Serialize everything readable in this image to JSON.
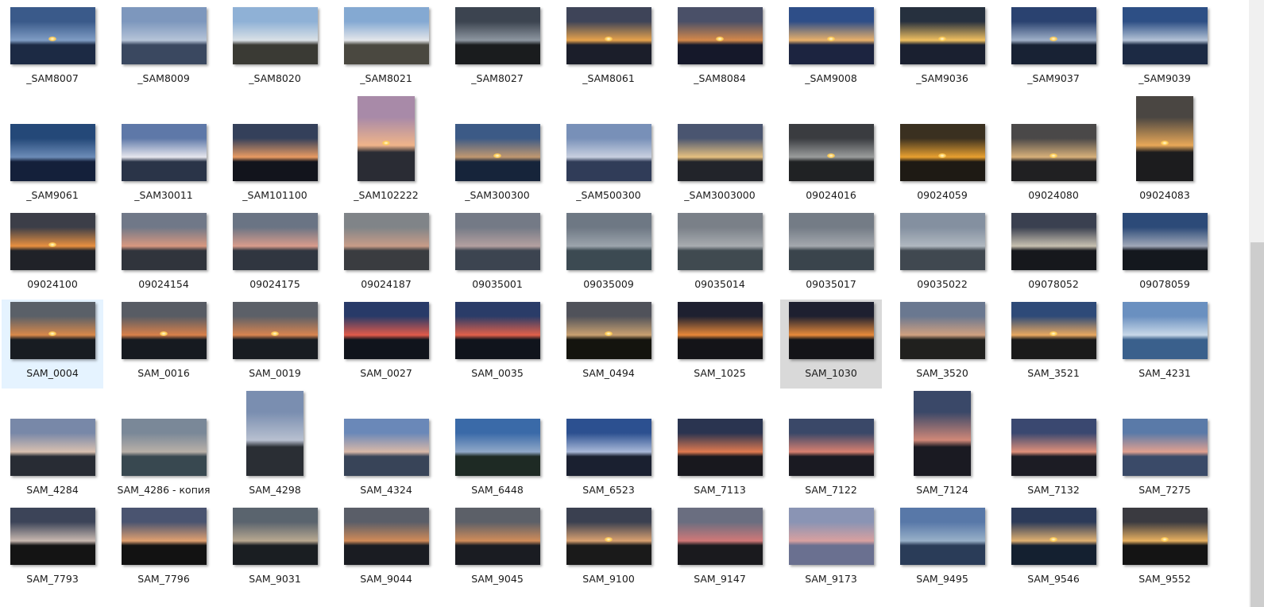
{
  "rows": [
    {
      "tall": false,
      "items": [
        {
          "name": "_SAM8007",
          "orient": "landscape",
          "c": [
            "#3a5a8a",
            "#7f9cc4",
            "#1c2a44"
          ],
          "sun": true
        },
        {
          "name": "_SAM8009",
          "orient": "landscape",
          "c": [
            "#7d97bd",
            "#b6c4d8",
            "#3a4860"
          ]
        },
        {
          "name": "_SAM8020",
          "orient": "landscape",
          "c": [
            "#8fb1d6",
            "#d9e0e6",
            "#3a3a34"
          ]
        },
        {
          "name": "_SAM8021",
          "orient": "landscape",
          "c": [
            "#84a9d2",
            "#e3e6ea",
            "#4a4840"
          ]
        },
        {
          "name": "_SAM8027",
          "orient": "landscape",
          "c": [
            "#3c4450",
            "#8d96a0",
            "#1a1c1e"
          ]
        },
        {
          "name": "_SAM8061",
          "orient": "landscape",
          "c": [
            "#3e4458",
            "#e6a24c",
            "#1b1e2a"
          ],
          "sun": true
        },
        {
          "name": "_SAM8084",
          "orient": "landscape",
          "c": [
            "#4a5068",
            "#d4884a",
            "#15182a"
          ],
          "sun": true
        },
        {
          "name": "_SAM9008",
          "orient": "landscape",
          "c": [
            "#2e4e88",
            "#e8b06a",
            "#1c2440"
          ],
          "sun": true
        },
        {
          "name": "_SAM9036",
          "orient": "landscape",
          "c": [
            "#26303e",
            "#f0c060",
            "#1a2030"
          ],
          "sun": true
        },
        {
          "name": "_SAM9037",
          "orient": "landscape",
          "c": [
            "#2a4270",
            "#9fb0c8",
            "#182234"
          ],
          "sun": true
        },
        {
          "name": "_SAM9039",
          "orient": "landscape",
          "c": [
            "#2d4f85",
            "#b3c2d6",
            "#1c2a44"
          ]
        }
      ]
    },
    {
      "tall": true,
      "items": [
        {
          "name": "_SAM9061",
          "orient": "landscape",
          "c": [
            "#244878",
            "#6c8cb8",
            "#14203a"
          ]
        },
        {
          "name": "_SAM30011",
          "orient": "landscape",
          "c": [
            "#5e78a8",
            "#e6e6ee",
            "#2a3448"
          ]
        },
        {
          "name": "_SAM101100",
          "orient": "landscape",
          "c": [
            "#34405a",
            "#e89a62",
            "#12141c"
          ]
        },
        {
          "name": "_SAM102222",
          "orient": "portrait",
          "c": [
            "#a88aa8",
            "#f0b48a",
            "#2a2c34"
          ],
          "sun": true
        },
        {
          "name": "_SAM300300",
          "orient": "landscape",
          "c": [
            "#3c5a86",
            "#c09870",
            "#16243a"
          ],
          "sun": true
        },
        {
          "name": "_SAM500300",
          "orient": "landscape",
          "c": [
            "#7890b8",
            "#c8d0e0",
            "#303c58"
          ]
        },
        {
          "name": "_SAM3003000",
          "orient": "landscape",
          "c": [
            "#4a5570",
            "#e6c080",
            "#22242a"
          ]
        },
        {
          "name": "09024016",
          "orient": "landscape",
          "c": [
            "#3a3c40",
            "#9a9c9c",
            "#202224"
          ],
          "sun": true
        },
        {
          "name": "09024059",
          "orient": "landscape",
          "c": [
            "#3a3020",
            "#e8a030",
            "#1e1a14"
          ],
          "sun": true
        },
        {
          "name": "09024080",
          "orient": "landscape",
          "c": [
            "#4a4848",
            "#d8b07a",
            "#202022"
          ],
          "sun": true
        },
        {
          "name": "09024083",
          "orient": "portrait",
          "c": [
            "#4a4642",
            "#e8a858",
            "#1c1c1e"
          ],
          "sun": true
        }
      ]
    },
    {
      "tall": false,
      "items": [
        {
          "name": "09024100",
          "orient": "landscape",
          "c": [
            "#3c3e48",
            "#e89040",
            "#202228"
          ],
          "sun": true
        },
        {
          "name": "09024154",
          "orient": "landscape",
          "c": [
            "#707888",
            "#d89880",
            "#30343c"
          ]
        },
        {
          "name": "09024175",
          "orient": "landscape",
          "c": [
            "#6a7484",
            "#d89c8c",
            "#303640"
          ]
        },
        {
          "name": "09024187",
          "orient": "landscape",
          "c": [
            "#808488",
            "#c89c88",
            "#3a3c40"
          ]
        },
        {
          "name": "09035001",
          "orient": "landscape",
          "c": [
            "#747a86",
            "#b4a0a0",
            "#3c4450"
          ]
        },
        {
          "name": "09035009",
          "orient": "landscape",
          "c": [
            "#6e7884",
            "#9ca4ac",
            "#3c4a52"
          ]
        },
        {
          "name": "09035014",
          "orient": "landscape",
          "c": [
            "#7a8088",
            "#a8acb0",
            "#404a50"
          ]
        },
        {
          "name": "09035017",
          "orient": "landscape",
          "c": [
            "#747c86",
            "#a4a8ae",
            "#3a444c"
          ]
        },
        {
          "name": "09035022",
          "orient": "landscape",
          "c": [
            "#8490a0",
            "#b0b8c0",
            "#404850"
          ]
        },
        {
          "name": "09078052",
          "orient": "landscape",
          "c": [
            "#3a4050",
            "#c8c0b0",
            "#16181c"
          ]
        },
        {
          "name": "09078059",
          "orient": "landscape",
          "c": [
            "#2c4a78",
            "#a0a8b8",
            "#14181e"
          ]
        }
      ]
    },
    {
      "tall": false,
      "items": [
        {
          "name": "SAM_0004",
          "orient": "landscape",
          "c": [
            "#5a6068",
            "#d8884a",
            "#181c22"
          ],
          "sun": true,
          "state": "focused"
        },
        {
          "name": "SAM_0016",
          "orient": "landscape",
          "c": [
            "#585c64",
            "#d8804a",
            "#161a20"
          ],
          "sun": true
        },
        {
          "name": "SAM_0019",
          "orient": "landscape",
          "c": [
            "#5c6068",
            "#d88450",
            "#181c22"
          ],
          "sun": true
        },
        {
          "name": "SAM_0027",
          "orient": "landscape",
          "c": [
            "#283a68",
            "#e05a4a",
            "#10141c"
          ]
        },
        {
          "name": "SAM_0035",
          "orient": "landscape",
          "c": [
            "#2a3c68",
            "#e0604a",
            "#10141c"
          ]
        },
        {
          "name": "SAM_0494",
          "orient": "landscape",
          "c": [
            "#50525a",
            "#c8a070",
            "#14140e"
          ],
          "sun": true
        },
        {
          "name": "SAM_1025",
          "orient": "landscape",
          "c": [
            "#1e2030",
            "#e88838",
            "#141418"
          ]
        },
        {
          "name": "SAM_1030",
          "orient": "landscape",
          "c": [
            "#1e2030",
            "#e88a3a",
            "#141418"
          ],
          "state": "selected"
        },
        {
          "name": "SAM_3520",
          "orient": "landscape",
          "c": [
            "#6a7890",
            "#d0a080",
            "#20201e"
          ]
        },
        {
          "name": "SAM_3521",
          "orient": "landscape",
          "c": [
            "#2e4a78",
            "#e8a860",
            "#1a1a1a"
          ],
          "sun": true
        },
        {
          "name": "SAM_4231",
          "orient": "landscape",
          "c": [
            "#6a90c0",
            "#c8d8e8",
            "#3a608c"
          ]
        }
      ]
    },
    {
      "tall": true,
      "items": [
        {
          "name": "SAM_4284",
          "orient": "landscape",
          "c": [
            "#7888a8",
            "#d8c0b0",
            "#282c34"
          ]
        },
        {
          "name": "SAM_4286 - копия",
          "orient": "landscape",
          "c": [
            "#7a8898",
            "#b8b0a8",
            "#384850"
          ]
        },
        {
          "name": "SAM_4298",
          "orient": "portrait",
          "c": [
            "#7a8eb0",
            "#b8c0d0",
            "#2a2e34"
          ]
        },
        {
          "name": "SAM_4324",
          "orient": "landscape",
          "c": [
            "#6a88b8",
            "#d8b8a8",
            "#384458"
          ]
        },
        {
          "name": "SAM_6448",
          "orient": "landscape",
          "c": [
            "#3a6aa8",
            "#90a8c8",
            "#1e2a24"
          ]
        },
        {
          "name": "SAM_6523",
          "orient": "landscape",
          "c": [
            "#2c5090",
            "#a8b8d8",
            "#1a2030"
          ]
        },
        {
          "name": "SAM_7113",
          "orient": "landscape",
          "c": [
            "#2a3450",
            "#e07a50",
            "#18181e"
          ]
        },
        {
          "name": "SAM_7122",
          "orient": "landscape",
          "c": [
            "#3a4868",
            "#d88070",
            "#1a1a22"
          ]
        },
        {
          "name": "SAM_7124",
          "orient": "portrait",
          "c": [
            "#3a4868",
            "#d08878",
            "#1a1a22"
          ]
        },
        {
          "name": "SAM_7132",
          "orient": "landscape",
          "c": [
            "#3a4870",
            "#e0907a",
            "#1c1c24"
          ]
        },
        {
          "name": "SAM_7275",
          "orient": "landscape",
          "c": [
            "#5a7aa8",
            "#e0a090",
            "#3a4a68"
          ]
        }
      ]
    },
    {
      "tall": false,
      "items": [
        {
          "name": "SAM_7793",
          "orient": "landscape",
          "c": [
            "#3c4458",
            "#c8b8b0",
            "#141414"
          ]
        },
        {
          "name": "SAM_7796",
          "orient": "landscape",
          "c": [
            "#4a5470",
            "#e0a070",
            "#121212"
          ]
        },
        {
          "name": "SAM_9031",
          "orient": "landscape",
          "c": [
            "#5a646e",
            "#b8a890",
            "#1a1e22"
          ]
        },
        {
          "name": "SAM_9044",
          "orient": "landscape",
          "c": [
            "#5a5e68",
            "#d08a58",
            "#1a1c22"
          ]
        },
        {
          "name": "SAM_9045",
          "orient": "landscape",
          "c": [
            "#5c6068",
            "#d08c5a",
            "#1a1c22"
          ]
        },
        {
          "name": "SAM_9100",
          "orient": "landscape",
          "c": [
            "#3a4050",
            "#d8a070",
            "#1a1a1a"
          ],
          "sun": true
        },
        {
          "name": "SAM_9147",
          "orient": "landscape",
          "c": [
            "#6a6e80",
            "#d07878",
            "#1a1a1e"
          ]
        },
        {
          "name": "SAM_9173",
          "orient": "landscape",
          "c": [
            "#8a94b4",
            "#d8a0a0",
            "#6a7090"
          ]
        },
        {
          "name": "SAM_9495",
          "orient": "landscape",
          "c": [
            "#5878a8",
            "#98b0c8",
            "#2a3c58"
          ]
        },
        {
          "name": "SAM_9546",
          "orient": "landscape",
          "c": [
            "#2c3a58",
            "#e0b070",
            "#142030"
          ],
          "sun": true
        },
        {
          "name": "SAM_9552",
          "orient": "landscape",
          "c": [
            "#3a3a40",
            "#e8b060",
            "#141414"
          ],
          "sun": true
        }
      ]
    }
  ]
}
